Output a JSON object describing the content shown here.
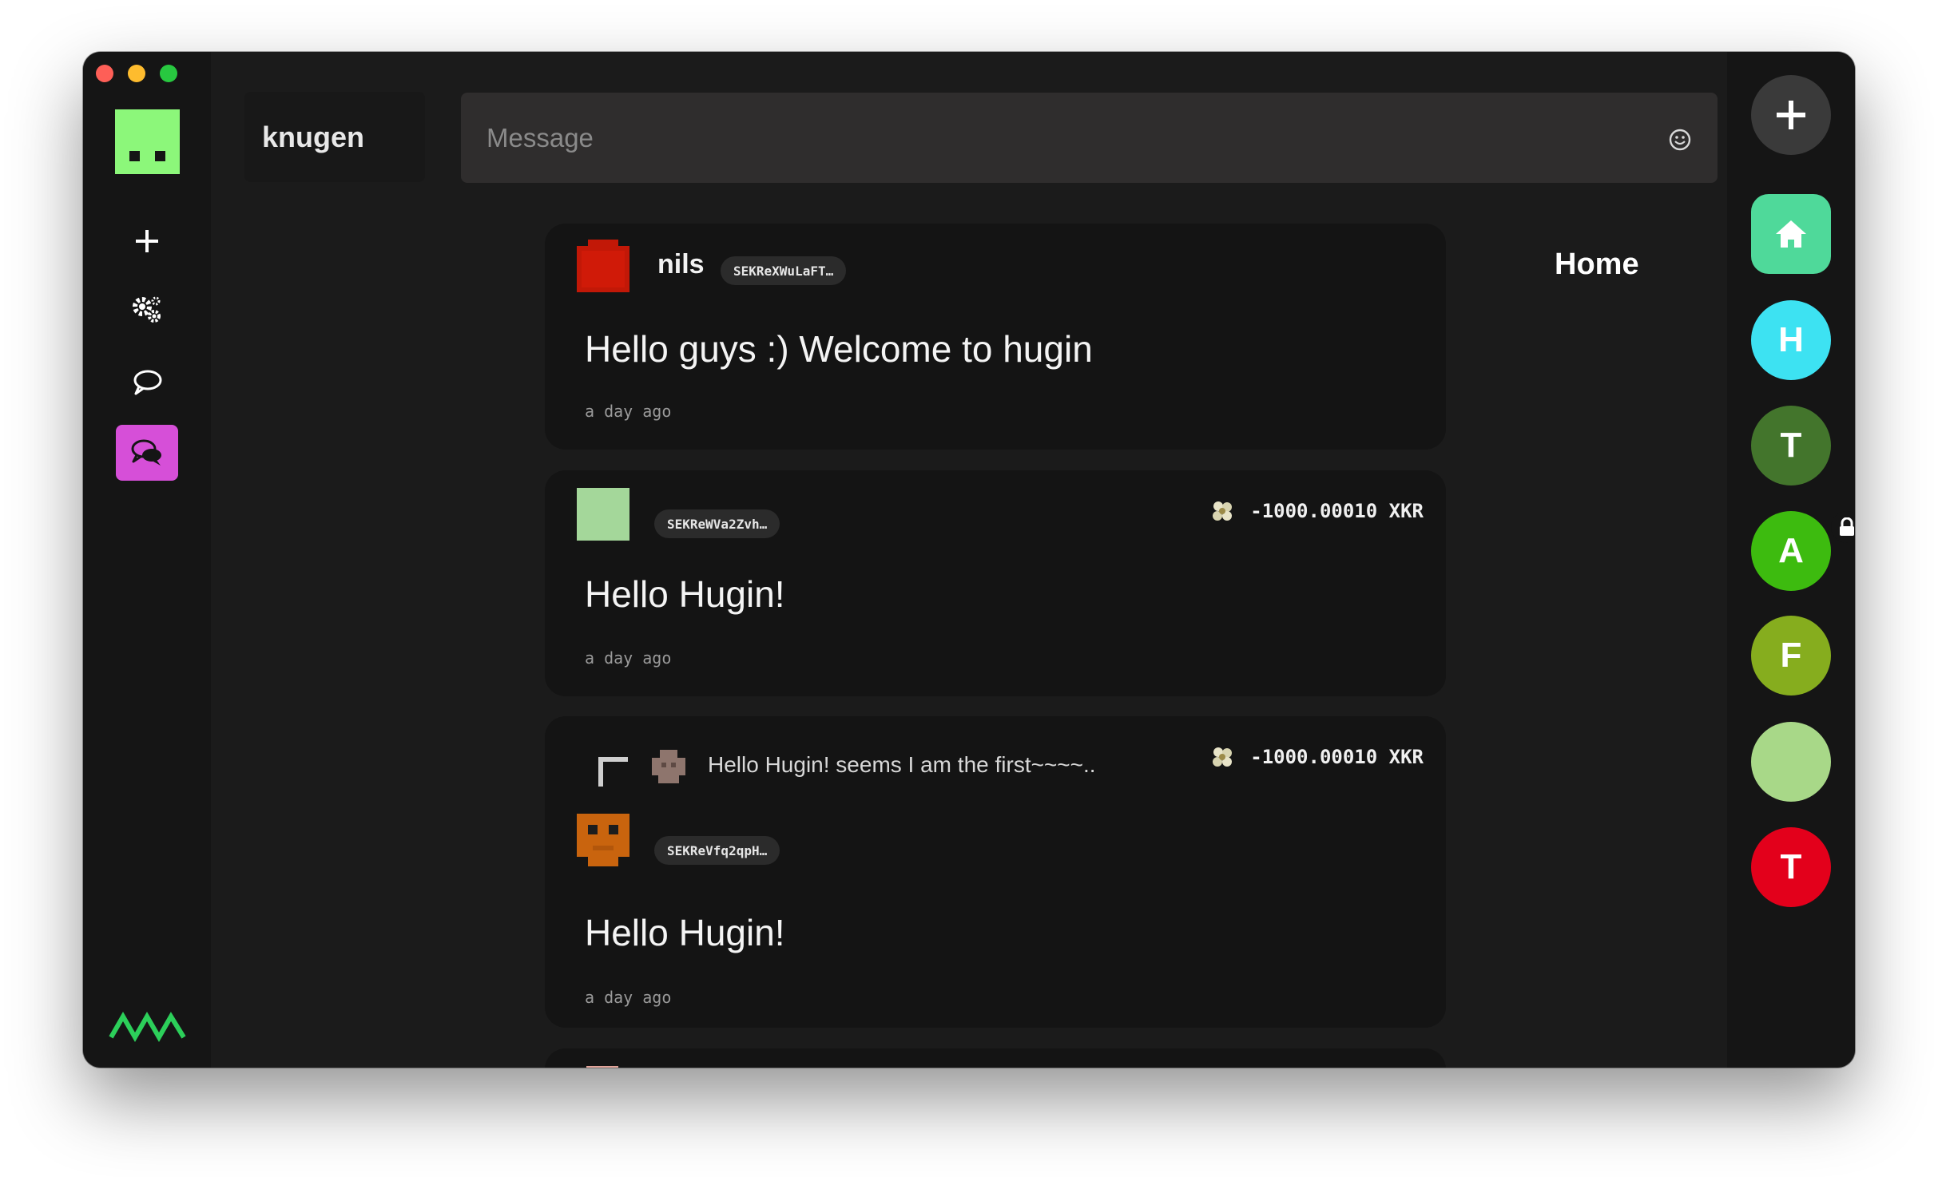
{
  "window": {
    "traffic_lights": [
      "close",
      "minimize",
      "zoom"
    ]
  },
  "left_nav": {
    "items": [
      {
        "icon": "plus-icon"
      },
      {
        "icon": "gears-icon"
      },
      {
        "icon": "chat-bubble-icon"
      },
      {
        "icon": "group-chat-icon",
        "active": true
      }
    ],
    "logo": "hugin-wave-logo"
  },
  "header": {
    "channel_name": "knugen",
    "message_placeholder": "Message",
    "emoji_icon": "smiley-icon"
  },
  "page": {
    "title": "Home"
  },
  "messages": [
    {
      "nickname": "nils",
      "address": "SEKReXWuLaFT…",
      "text": "Hello guys :) Welcome to hugin",
      "time": "a day ago"
    },
    {
      "nickname": "",
      "address": "SEKReWVa2Zvh…",
      "text": "Hello Hugin!",
      "time": "a day ago",
      "tip": "-1000.00010 XKR"
    },
    {
      "nickname": "",
      "address": "SEKReVfq2qpH…",
      "text": "Hello Hugin!",
      "time": "a day ago",
      "tip": "-1000.00010 XKR",
      "reply_to": "Hello Hugin! seems I am the first~~~~.."
    }
  ],
  "boards": [
    {
      "label": "",
      "icon": "home-icon",
      "color": "#4fd99a"
    },
    {
      "label": "H",
      "color": "#3de2f2"
    },
    {
      "label": "T",
      "color": "#43752c"
    },
    {
      "label": "A",
      "color": "#3dbb0f",
      "locked": true
    },
    {
      "label": "F",
      "color": "#86ad1e"
    },
    {
      "label": "",
      "color": "#a8d888"
    },
    {
      "label": "T",
      "color": "#e3001b"
    }
  ],
  "add_board_icon": "plus-icon"
}
